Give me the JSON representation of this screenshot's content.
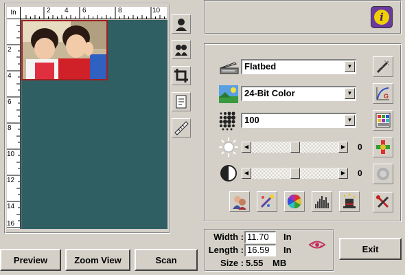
{
  "ruler": {
    "corner": "In",
    "top_ticks": [
      "2",
      "4",
      "6",
      "8",
      "10"
    ],
    "left_ticks": [
      "2",
      "4",
      "6",
      "8",
      "10",
      "12",
      "14",
      "16"
    ]
  },
  "tools": [
    {
      "name": "portrait-tool-icon"
    },
    {
      "name": "mirror-tool-icon"
    },
    {
      "name": "crop-tool-icon"
    },
    {
      "name": "page-tool-icon"
    },
    {
      "name": "ruler-tool-icon"
    }
  ],
  "buttons": {
    "preview": "Preview",
    "zoom_view": "Zoom View",
    "scan": "Scan",
    "exit": "Exit",
    "info": "i"
  },
  "settings": {
    "source": "Flatbed",
    "color_mode": "24-Bit Color",
    "resolution": "100",
    "brightness": "0",
    "contrast": "0",
    "brightness_level": 0.5,
    "contrast_level": 0.5
  },
  "size": {
    "width_label": "Width :",
    "width_value": "11.70",
    "width_unit": "In",
    "length_label": "Length :",
    "length_value": "16.59",
    "length_unit": "In",
    "size_label": "Size :",
    "size_value": "5.55",
    "size_unit": "MB"
  },
  "colors": {
    "canvas": "#2f5f63",
    "selection_border": "#a02020",
    "info_button": "#6a3aa0"
  }
}
